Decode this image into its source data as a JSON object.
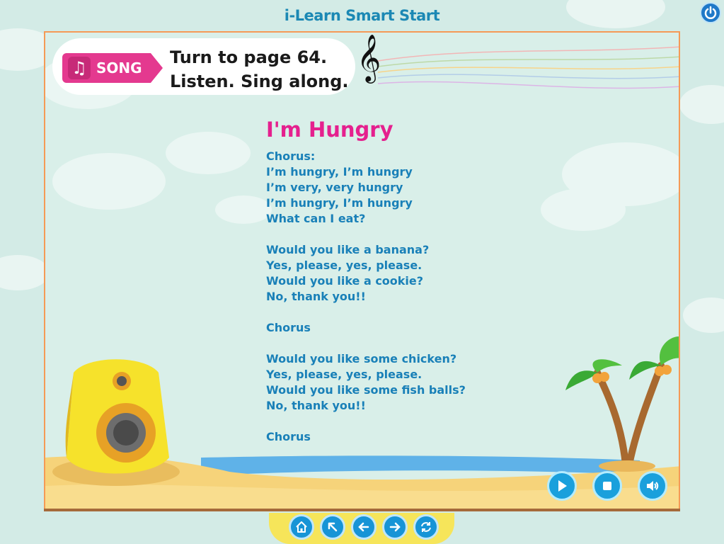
{
  "app": {
    "title": "i-Learn Smart Start"
  },
  "banner": {
    "tag_label": "SONG",
    "instruction_line1": "Turn to page 64.",
    "instruction_line2": "Listen. Sing along."
  },
  "song": {
    "title": "I'm Hungry",
    "lines": [
      "Chorus:",
      "I’m hungry, I’m hungry",
      "I’m very, very hungry",
      "I’m hungry, I’m hungry",
      "What can I eat?",
      "",
      "Would you like a banana?",
      "Yes, please, yes, please.",
      "Would you like a cookie?",
      "No, thank you!!",
      "",
      "Chorus",
      "",
      "Would you like some chicken?",
      "Yes, please, yes, please.",
      "Would you like some fish balls?",
      "No, thank you!!",
      "",
      "Chorus"
    ]
  },
  "controls": [
    "play-icon",
    "stop-icon",
    "volume-icon"
  ],
  "nav": [
    "home-icon",
    "arrow-up-left-icon",
    "arrow-left-icon",
    "arrow-right-icon",
    "refresh-icon"
  ],
  "colors": {
    "accent_pink": "#e5208e",
    "lyric_blue": "#1980b8",
    "button_blue": "#1aa0dc",
    "frame_orange": "#f59a56",
    "nav_yellow": "#f6e55a"
  }
}
